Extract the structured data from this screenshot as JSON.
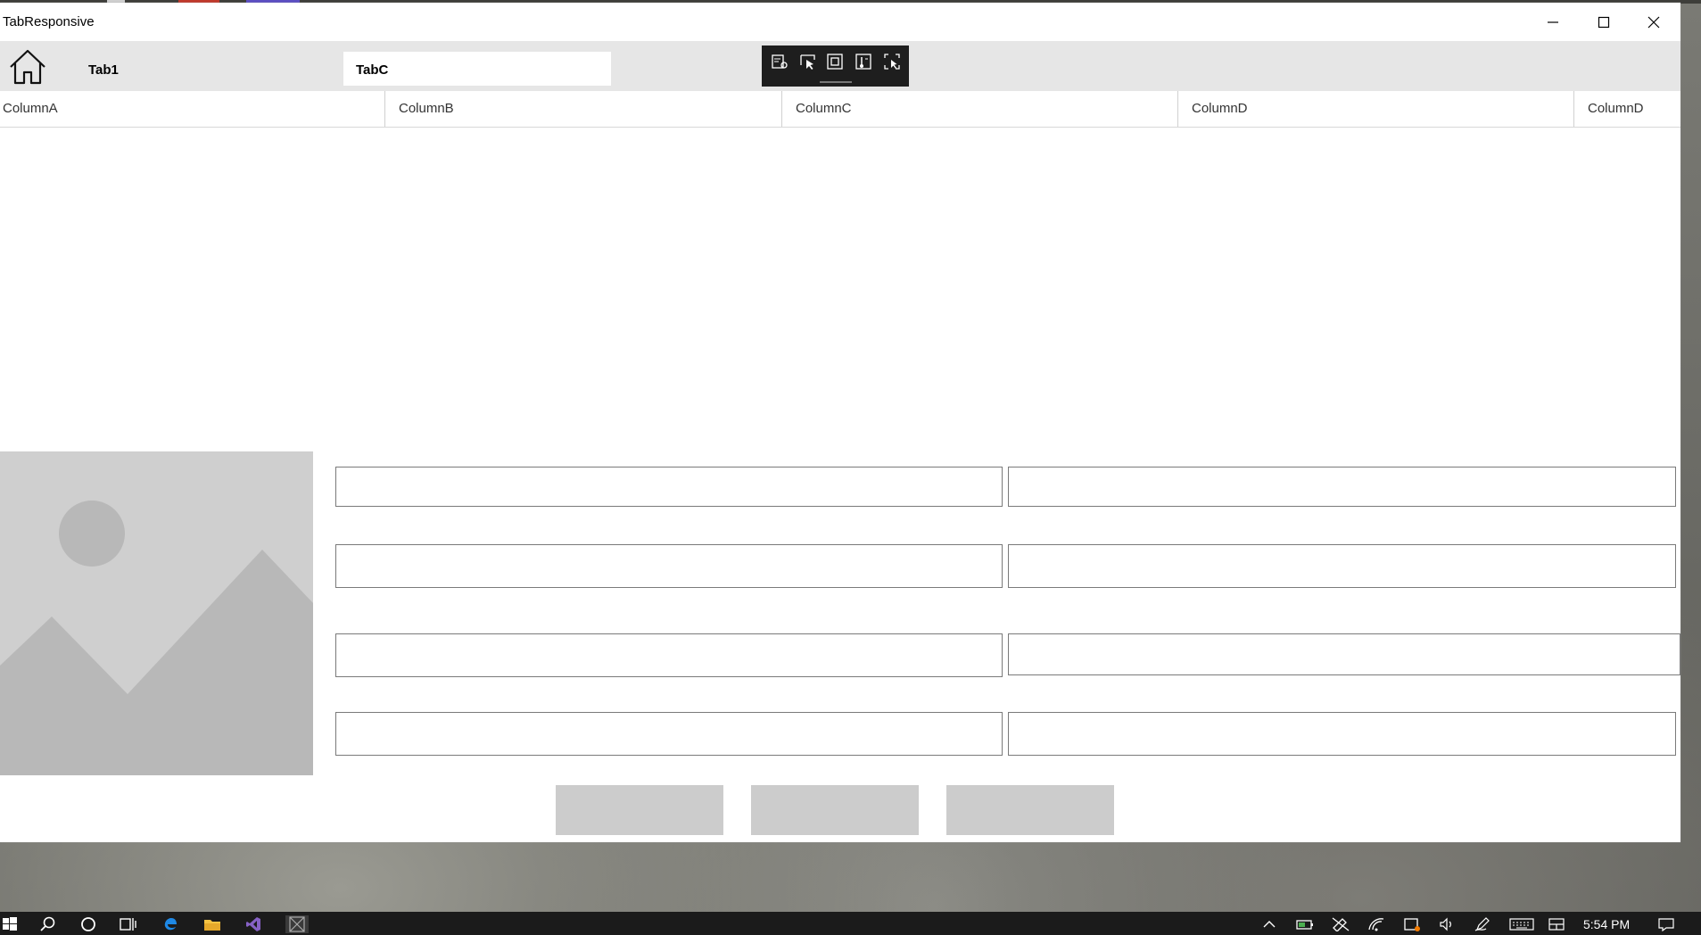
{
  "window": {
    "title": "TabResponsive"
  },
  "tabs": {
    "tab1_label": "Tab1",
    "tabc_label": "TabC"
  },
  "grid": {
    "columns": [
      "ColumnA",
      "ColumnB",
      "ColumnC",
      "ColumnD",
      "ColumnD"
    ]
  },
  "form": {
    "fields": [
      "",
      "",
      "",
      "",
      "",
      "",
      "",
      ""
    ],
    "buttons": [
      "",
      "",
      ""
    ]
  },
  "taskbar": {
    "time": "5:54 PM"
  },
  "colors": {
    "window_bg": "#ffffff",
    "tabbar_bg": "#e6e6e6",
    "debug_toolbar_bg": "#1e1e1e",
    "taskbar_bg": "#1b1b1b",
    "placeholder_bg": "#cfcfcf",
    "button_bg": "#cccccc"
  },
  "icons": {
    "home": "home-icon",
    "minimize": "minimize-icon",
    "maximize": "maximize-icon",
    "close": "close-icon",
    "debug_tools": [
      "live-visual-tree-icon",
      "select-element-icon",
      "display-layout-adorners-icon",
      "track-focus-icon",
      "binding-failures-icon"
    ],
    "taskbar_left": [
      "windows-start-icon",
      "search-icon",
      "cortana-icon",
      "task-view-icon",
      "edge-icon",
      "file-explorer-icon",
      "visual-studio-icon",
      "app-icon"
    ],
    "taskbar_tray": [
      "show-hidden-icons-icon",
      "battery-icon",
      "network-icon",
      "wifi-icon",
      "security-icon",
      "volume-icon",
      "pen-icon",
      "keyboard-icon",
      "tablet-icon",
      "notification-icon"
    ]
  }
}
